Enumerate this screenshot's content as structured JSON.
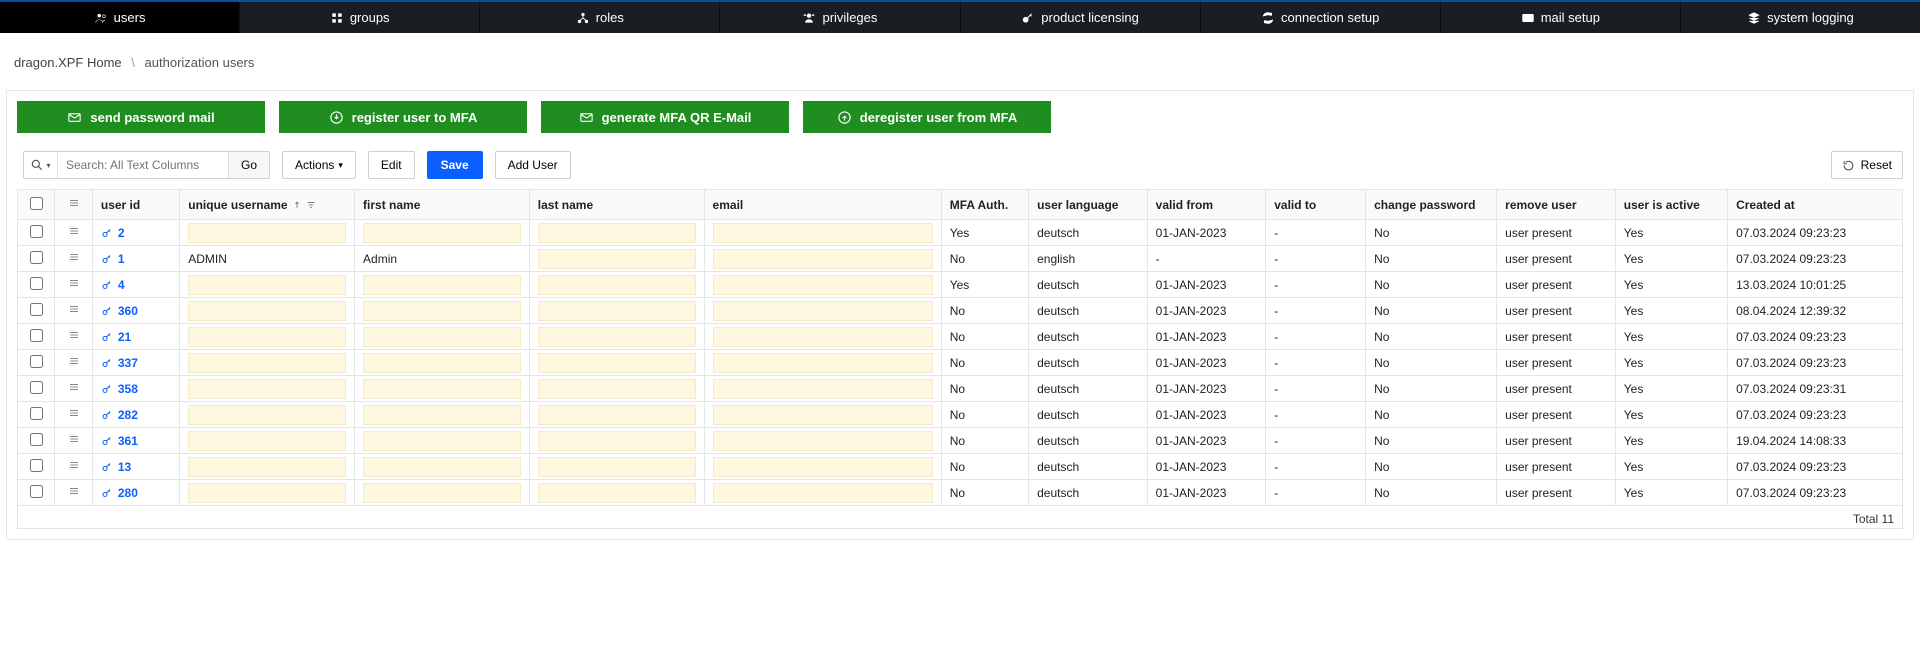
{
  "nav": {
    "users": "users",
    "groups": "groups",
    "roles": "roles",
    "privileges": "privileges",
    "product_licensing": "product licensing",
    "connection_setup": "connection setup",
    "mail_setup": "mail setup",
    "system_logging": "system logging"
  },
  "breadcrumb": {
    "home": "dragon.XPF Home",
    "current": "authorization users"
  },
  "actions": {
    "send_password_mail": "send password mail",
    "register_mfa": "register user to MFA",
    "generate_mfa_qr": "generate MFA QR E-Mail",
    "deregister_mfa": "deregister user from MFA"
  },
  "toolbar": {
    "search_placeholder": "Search: All Text Columns",
    "go": "Go",
    "actions": "Actions",
    "edit": "Edit",
    "save": "Save",
    "add_user": "Add User",
    "reset": "Reset"
  },
  "columns": {
    "user_id": "user id",
    "unique_username": "unique username",
    "first_name": "first name",
    "last_name": "last name",
    "email": "email",
    "mfa_auth": "MFA Auth.",
    "user_language": "user language",
    "valid_from": "valid from",
    "valid_to": "valid to",
    "change_password": "change password",
    "remove_user": "remove user",
    "user_is_active": "user is active",
    "created_at": "Created at"
  },
  "rows": [
    {
      "id": "2",
      "uname": "",
      "fname": "",
      "lname": "",
      "email": "",
      "mfa": "Yes",
      "lang": "deutsch",
      "vfrom": "01-JAN-2023",
      "vto": "-",
      "chg": "No",
      "rem": "user present",
      "act": "Yes",
      "crt": "07.03.2024 09:23:23",
      "editable": true
    },
    {
      "id": "1",
      "uname": "ADMIN",
      "fname": "Admin",
      "lname": "",
      "email": "",
      "mfa": "No",
      "lang": "english",
      "vfrom": "-",
      "vto": "-",
      "chg": "No",
      "rem": "user present",
      "act": "Yes",
      "crt": "07.03.2024 09:23:23",
      "editable": true,
      "uname_ro": true,
      "fname_ro": true
    },
    {
      "id": "4",
      "uname": "",
      "fname": "",
      "lname": "",
      "email": "",
      "mfa": "Yes",
      "lang": "deutsch",
      "vfrom": "01-JAN-2023",
      "vto": "-",
      "chg": "No",
      "rem": "user present",
      "act": "Yes",
      "crt": "13.03.2024 10:01:25",
      "editable": true
    },
    {
      "id": "360",
      "uname": "",
      "fname": "",
      "lname": "",
      "email": "",
      "mfa": "No",
      "lang": "deutsch",
      "vfrom": "01-JAN-2023",
      "vto": "-",
      "chg": "No",
      "rem": "user present",
      "act": "Yes",
      "crt": "08.04.2024 12:39:32",
      "editable": true
    },
    {
      "id": "21",
      "uname": "",
      "fname": "",
      "lname": "",
      "email": "",
      "mfa": "No",
      "lang": "deutsch",
      "vfrom": "01-JAN-2023",
      "vto": "-",
      "chg": "No",
      "rem": "user present",
      "act": "Yes",
      "crt": "07.03.2024 09:23:23",
      "editable": true
    },
    {
      "id": "337",
      "uname": "",
      "fname": "",
      "lname": "",
      "email": "",
      "mfa": "No",
      "lang": "deutsch",
      "vfrom": "01-JAN-2023",
      "vto": "-",
      "chg": "No",
      "rem": "user present",
      "act": "Yes",
      "crt": "07.03.2024 09:23:23",
      "editable": true
    },
    {
      "id": "358",
      "uname": "",
      "fname": "",
      "lname": "",
      "email": "",
      "mfa": "No",
      "lang": "deutsch",
      "vfrom": "01-JAN-2023",
      "vto": "-",
      "chg": "No",
      "rem": "user present",
      "act": "Yes",
      "crt": "07.03.2024 09:23:31",
      "editable": true
    },
    {
      "id": "282",
      "uname": "",
      "fname": "",
      "lname": "",
      "email": "",
      "mfa": "No",
      "lang": "deutsch",
      "vfrom": "01-JAN-2023",
      "vto": "-",
      "chg": "No",
      "rem": "user present",
      "act": "Yes",
      "crt": "07.03.2024 09:23:23",
      "editable": true
    },
    {
      "id": "361",
      "uname": "",
      "fname": "",
      "lname": "",
      "email": "",
      "mfa": "No",
      "lang": "deutsch",
      "vfrom": "01-JAN-2023",
      "vto": "-",
      "chg": "No",
      "rem": "user present",
      "act": "Yes",
      "crt": "19.04.2024 14:08:33",
      "editable": true
    },
    {
      "id": "13",
      "uname": "",
      "fname": "",
      "lname": "",
      "email": "",
      "mfa": "No",
      "lang": "deutsch",
      "vfrom": "01-JAN-2023",
      "vto": "-",
      "chg": "No",
      "rem": "user present",
      "act": "Yes",
      "crt": "07.03.2024 09:23:23",
      "editable": true
    },
    {
      "id": "280",
      "uname": "",
      "fname": "",
      "lname": "",
      "email": "",
      "mfa": "No",
      "lang": "deutsch",
      "vfrom": "01-JAN-2023",
      "vto": "-",
      "chg": "No",
      "rem": "user present",
      "act": "Yes",
      "crt": "07.03.2024 09:23:23",
      "editable": true
    }
  ],
  "footer": {
    "total_label": "Total 11"
  }
}
